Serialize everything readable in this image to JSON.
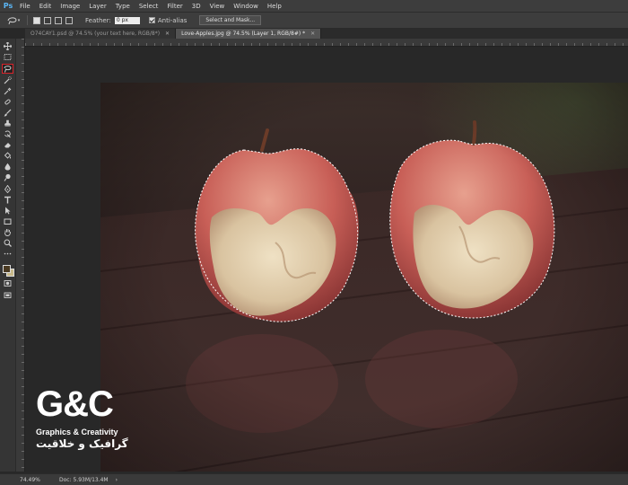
{
  "app": {
    "logo": "Ps"
  },
  "menu": [
    "File",
    "Edit",
    "Image",
    "Layer",
    "Type",
    "Select",
    "Filter",
    "3D",
    "View",
    "Window",
    "Help"
  ],
  "options": {
    "feather_label": "Feather:",
    "feather_value": "0 px",
    "antialias_label": "Anti-alias",
    "select_mask_label": "Select and Mask..."
  },
  "tabs": [
    {
      "label": "O74CAY1.psd @ 74.5% (your text here, RGB/8*)",
      "active": false
    },
    {
      "label": "Love-Apples.jpg @ 74.5% (Layer 1, RGB/8#) *",
      "active": true
    }
  ],
  "status": {
    "zoom": "74.49%",
    "doc": "Doc: 5.93M/13.4M",
    "arrow": "›"
  },
  "watermark": {
    "logo": "G&C",
    "line1": "Graphics & Creativity",
    "line2": "گرافیک و خلاقیت"
  },
  "colors": {
    "accent_active_tool": "#d8232a",
    "foreground": "#4a3a22",
    "background": "#c8b98a"
  },
  "icons": [
    "move-icon",
    "marquee-icon",
    "magnetic-lasso-icon",
    "quick-selection-icon",
    "eyedropper-icon",
    "healing-brush-icon",
    "brush-icon",
    "clone-stamp-icon",
    "history-brush-icon",
    "eraser-icon",
    "paint-bucket-icon",
    "blur-icon",
    "dodge-icon",
    "pen-icon",
    "type-icon",
    "path-selection-icon",
    "rectangle-icon",
    "hand-icon",
    "zoom-icon",
    "more-tools-icon",
    "color-swatches-icon",
    "quick-mask-icon",
    "screen-mode-icon"
  ]
}
